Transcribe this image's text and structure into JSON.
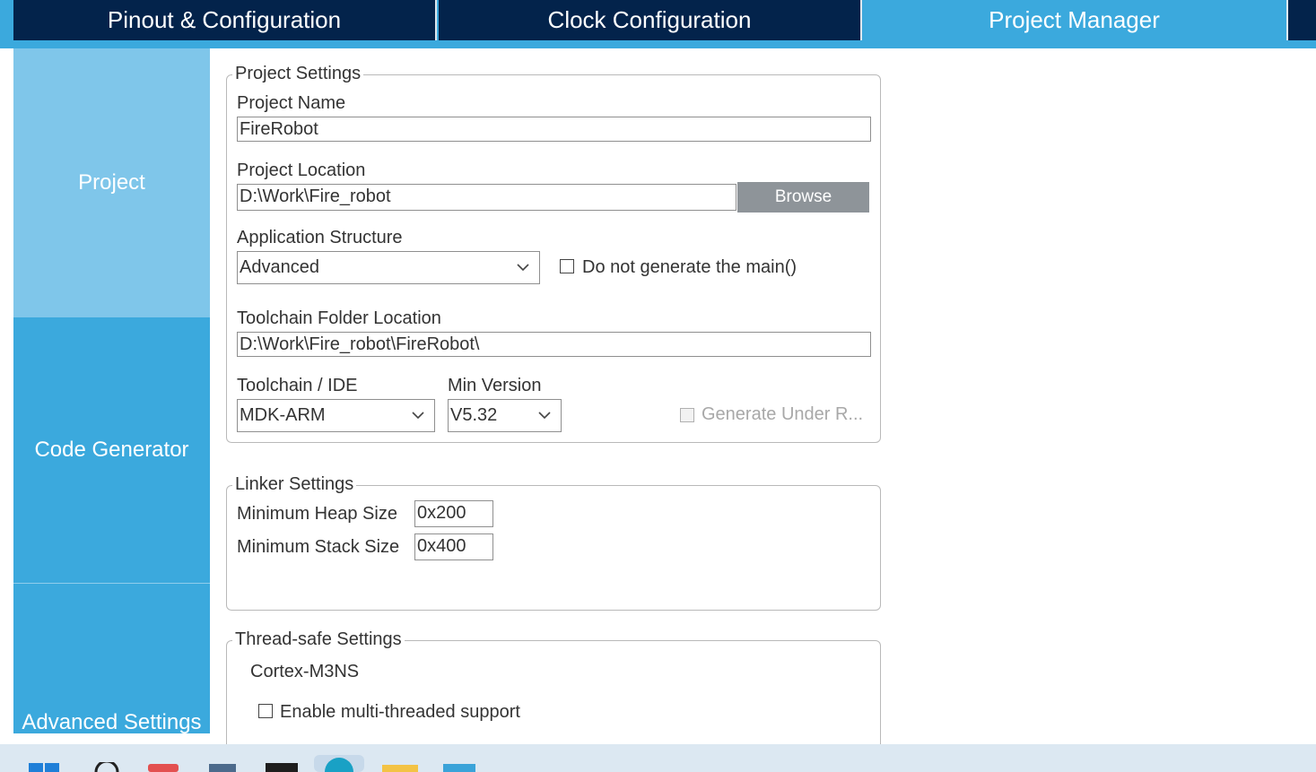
{
  "tabs": {
    "pinout": "Pinout & Configuration",
    "clock": "Clock Configuration",
    "project_manager": "Project Manager"
  },
  "sidebar": {
    "project": "Project",
    "code_generator": "Code Generator",
    "advanced_settings": "Advanced Settings"
  },
  "project_settings": {
    "legend": "Project Settings",
    "name_label": "Project Name",
    "name_value": "FireRobot",
    "location_label": "Project Location",
    "location_value": "D:\\Work\\Fire_robot",
    "browse_label": "Browse",
    "app_structure_label": "Application Structure",
    "app_structure_value": "Advanced",
    "no_main_label": "Do not generate the main()",
    "toolchain_folder_label": "Toolchain Folder Location",
    "toolchain_folder_value": "D:\\Work\\Fire_robot\\FireRobot\\",
    "toolchain_ide_label": "Toolchain / IDE",
    "toolchain_ide_value": "MDK-ARM",
    "min_version_label": "Min Version",
    "min_version_value": "V5.32",
    "generate_under_root_label": "Generate Under R..."
  },
  "linker_settings": {
    "legend": "Linker Settings",
    "heap_label": "Minimum Heap Size",
    "heap_value": "0x200",
    "stack_label": "Minimum Stack Size",
    "stack_value": "0x400"
  },
  "thread_safe_settings": {
    "legend": "Thread-safe Settings",
    "core": "Cortex-M3NS",
    "multithread_label": "Enable multi-threaded support"
  },
  "colors": {
    "dark_navy": "#03234b",
    "accent_blue": "#3ba9dd",
    "light_blue": "#7fc6ea",
    "button_gray": "#8e9499"
  }
}
